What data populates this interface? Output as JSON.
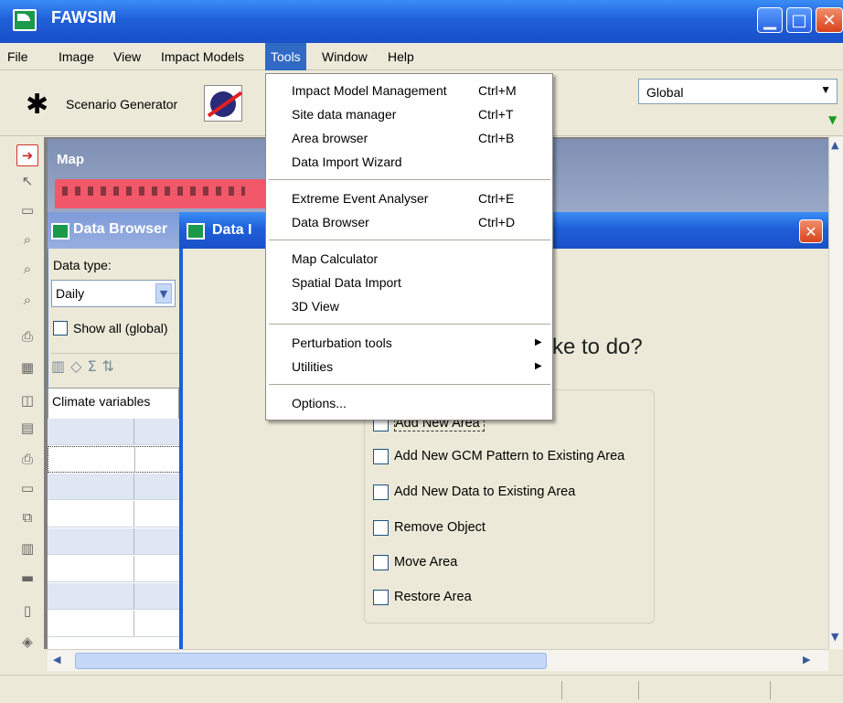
{
  "app": {
    "title": "FAWSIM"
  },
  "menubar": {
    "items": [
      "File",
      "Image",
      "View",
      "Impact Models",
      "Tools",
      "Window",
      "Help"
    ],
    "active": "Tools"
  },
  "toolbar": {
    "scenario_label": "Scenario Generator",
    "region_value": "Global"
  },
  "tools_menu": {
    "items": [
      {
        "label": "Impact Model Management",
        "shortcut": "Ctrl+M"
      },
      {
        "label": "Site data manager",
        "shortcut": "Ctrl+T"
      },
      {
        "label": "Area browser",
        "shortcut": "Ctrl+B"
      },
      {
        "label": "Data Import Wizard",
        "shortcut": ""
      },
      {
        "label": "Extreme Event Analyser",
        "shortcut": "Ctrl+E"
      },
      {
        "label": "Data Browser",
        "shortcut": "Ctrl+D"
      },
      {
        "label": "Map Calculator",
        "shortcut": ""
      },
      {
        "label": "Spatial Data Import",
        "shortcut": ""
      },
      {
        "label": "3D View",
        "shortcut": ""
      },
      {
        "label": "Perturbation tools",
        "shortcut": ""
      },
      {
        "label": "Utilities",
        "shortcut": ""
      },
      {
        "label": "Options...",
        "shortcut": ""
      }
    ]
  },
  "map_window": {
    "title": "Map"
  },
  "data_browser": {
    "title": "Data Browser",
    "data_type_label": "Data type:",
    "data_type_value": "Daily",
    "show_all_label": "Show all (global)",
    "tab_label": "Climate variables"
  },
  "wizard": {
    "title": "Data I",
    "question": "ke to do?",
    "options": [
      "Add New Area",
      "Add New GCM Pattern to Existing Area",
      "Add New Data to Existing Area",
      "Remove Object",
      "Move Area",
      "Restore Area"
    ]
  },
  "colors": {
    "xp_blue": "#1f5fd9",
    "menu_highlight": "#316ac5",
    "map_strip": "#f2576a"
  }
}
